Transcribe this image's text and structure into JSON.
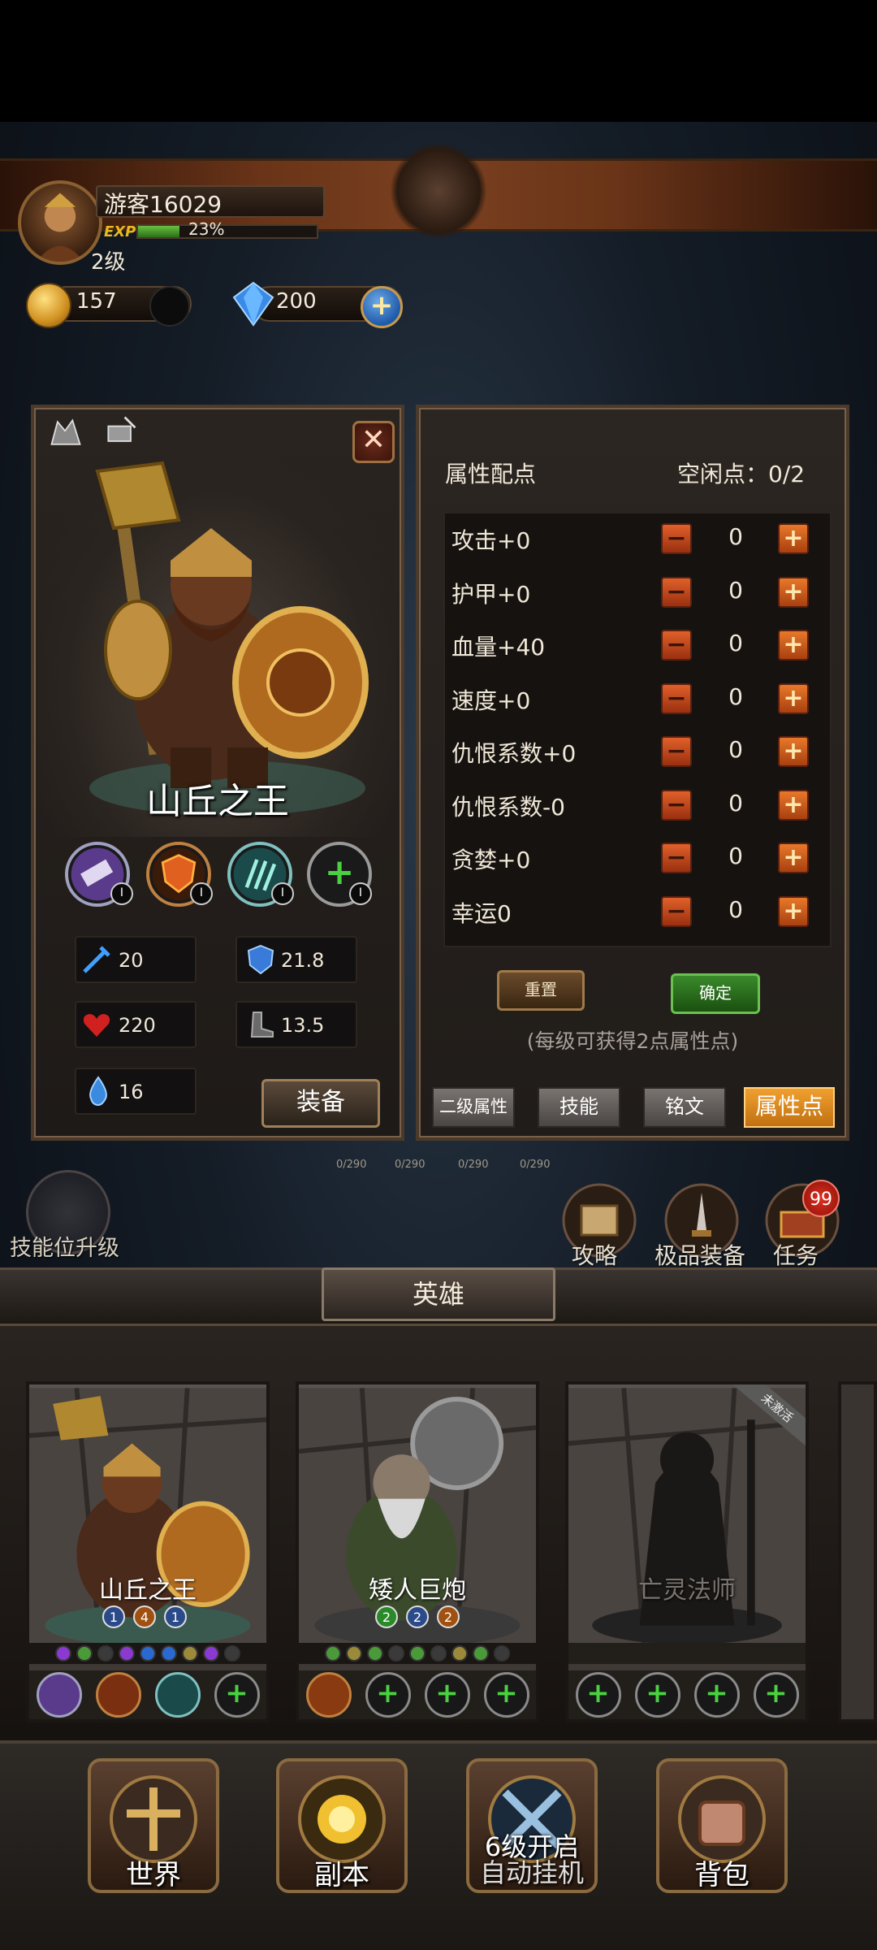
{
  "player": {
    "name": "游客16029",
    "exp_label": "EXP",
    "exp_percent_text": "23%",
    "exp_fraction": 0.23,
    "level": "2级"
  },
  "currency": {
    "gold": "157",
    "diamonds": "200",
    "add_icon": "plus-icon"
  },
  "hero": {
    "name": "山丘之王",
    "skill_levels": [
      "I",
      "I",
      "I",
      "I"
    ],
    "stats": {
      "attack": "20",
      "armor": "21.8",
      "hp": "220",
      "speed": "13.5",
      "mana": "16"
    },
    "equip_label": "装备"
  },
  "attributes": {
    "title": "属性配点",
    "free_points": "空闲点：0/2",
    "rows": [
      {
        "label": "攻击+0",
        "value": "0"
      },
      {
        "label": "护甲+0",
        "value": "0"
      },
      {
        "label": "血量+40",
        "value": "0"
      },
      {
        "label": "速度+0",
        "value": "0"
      },
      {
        "label": "仇恨系数+0",
        "value": "0"
      },
      {
        "label": "仇恨系数-0",
        "value": "0"
      },
      {
        "label": "贪婪+0",
        "value": "0"
      },
      {
        "label": "幸运0",
        "value": "0"
      }
    ],
    "minus_symbol": "−",
    "plus_symbol": "+",
    "reset_label": "重置",
    "confirm_label": "确定",
    "hint": "(每级可获得2点属性点)",
    "tabs": [
      "二级属性",
      "技能",
      "铭文",
      "属性点"
    ],
    "active_tab": "属性点"
  },
  "progress_marks": [
    "0/290",
    "0/290",
    "0/290",
    "0/290"
  ],
  "side": {
    "skill_upgrade": "技能位升级",
    "guide": "攻略",
    "top_gear": "极品装备",
    "quests": "任务",
    "quest_badge": "99"
  },
  "roster": {
    "title": "英雄",
    "cards": [
      {
        "name": "山丘之王",
        "ranks": [
          "1",
          "4",
          "1"
        ]
      },
      {
        "name": "矮人巨炮",
        "ranks": [
          "2",
          "2",
          "2"
        ]
      },
      {
        "name": "亡灵法师",
        "ribbon": "未激活"
      }
    ]
  },
  "nav": {
    "world": "世界",
    "dungeon": "副本",
    "idle": "自动挂机",
    "idle_overlay": "6级开启",
    "bag": "背包"
  },
  "colors": {
    "accent_gold": "#e8b820",
    "active_tab": "#f0a030",
    "confirm_green": "#3a8a2a",
    "badge_red": "#e03020"
  }
}
